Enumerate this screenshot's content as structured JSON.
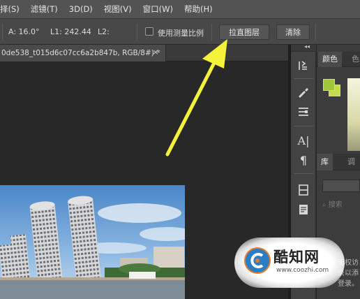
{
  "menubar": {
    "items": [
      "择(S)",
      "滤镜(T)",
      "3D(D)",
      "视图(V)",
      "窗口(W)",
      "帮助(H)"
    ]
  },
  "options": {
    "angle": "A: 16.0°",
    "l1": "L1: 242.44",
    "l2": "L2:",
    "use_scale_label": "使用测量比例",
    "straighten_button": "拉直图层",
    "clear_button": "清除"
  },
  "document": {
    "tab_title": "0de538_t015d6c07cc6a2b847b, RGB/8#) *",
    "close_glyph": "×"
  },
  "panels": {
    "collapse_glyph": "◂◂",
    "color_tab": "颜色",
    "swatches_tab": "色",
    "foreground_color": "#9fc53a",
    "background_color": "#c7d94a",
    "libraries_tab": "库",
    "adjustments_tab": "调",
    "search_placeholder": "搜索",
    "library_text": [
      "无权访",
      "录以添",
      "登录。"
    ]
  },
  "annotation": {
    "arrow_color": "#f5f23a"
  },
  "watermark": {
    "title": "酷知网",
    "url": "www.coozhi.com"
  }
}
